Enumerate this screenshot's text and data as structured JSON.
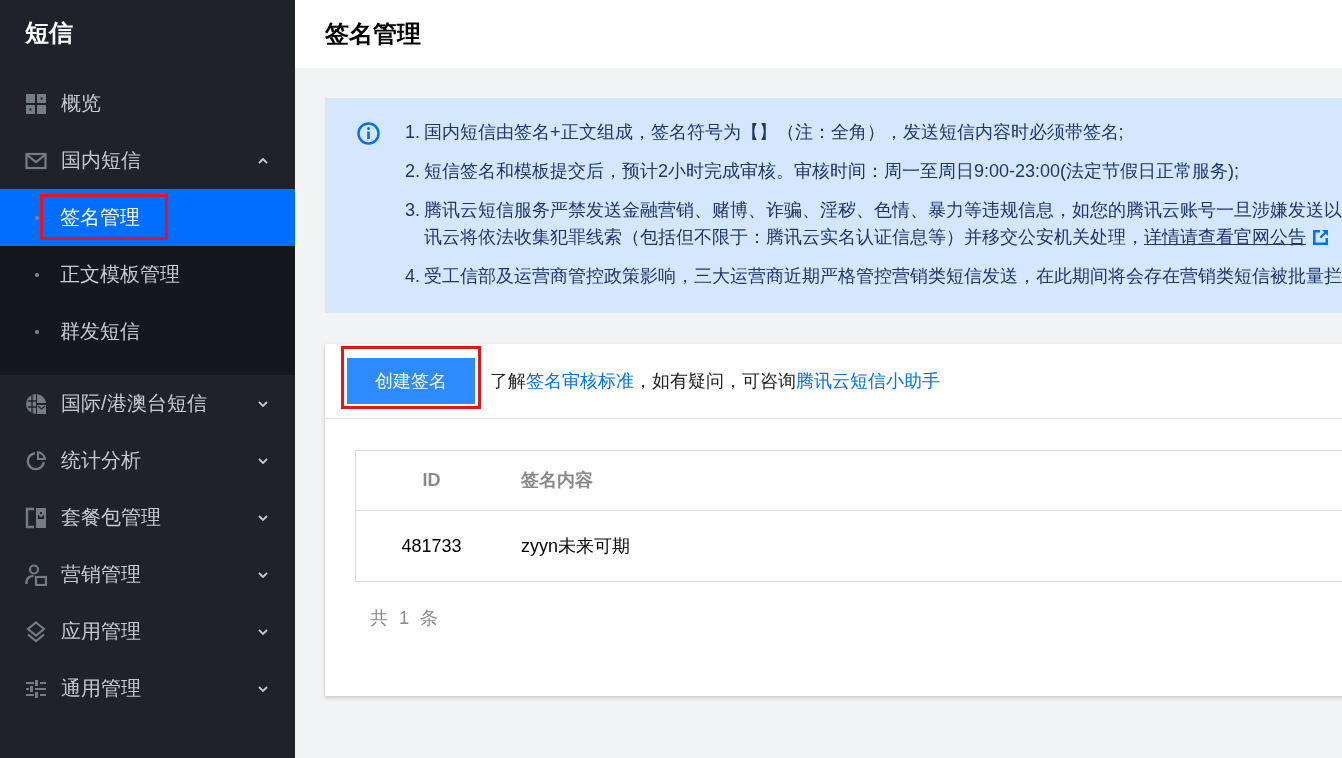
{
  "sidebar": {
    "title": "短信",
    "items": [
      {
        "label": "概览",
        "kind": "link",
        "selected": false
      },
      {
        "label": "国内短信",
        "kind": "group",
        "selected": false,
        "expanded": true,
        "children": [
          {
            "label": "签名管理",
            "selected": true,
            "highlighted": true
          },
          {
            "label": "正文模板管理",
            "selected": false,
            "highlighted": false
          },
          {
            "label": "群发短信",
            "selected": false,
            "highlighted": false
          }
        ]
      },
      {
        "label": "国际/港澳台短信",
        "kind": "group",
        "selected": false,
        "expanded": false
      },
      {
        "label": "统计分析",
        "kind": "group",
        "selected": false,
        "expanded": false
      },
      {
        "label": "套餐包管理",
        "kind": "group",
        "selected": false,
        "expanded": false
      },
      {
        "label": "营销管理",
        "kind": "group",
        "selected": false,
        "expanded": false
      },
      {
        "label": "应用管理",
        "kind": "group",
        "selected": false,
        "expanded": false
      },
      {
        "label": "通用管理",
        "kind": "group",
        "selected": false,
        "expanded": false
      }
    ]
  },
  "page": {
    "title": "签名管理"
  },
  "notice": {
    "items": [
      {
        "number": "1.",
        "text": "国内短信由签名+正文组成，签名符号为【】（注：全角），发送短信内容时必须带签名;"
      },
      {
        "number": "2.",
        "text": "短信签名和模板提交后，预计2小时完成审核。审核时间：周一至周日9:00-23:00(法定节假日正常服务);"
      },
      {
        "number": "3.",
        "text": "腾讯云短信服务严禁发送金融营销、赌博、诈骗、淫秽、色情、暴力等违规信息，如您的腾讯云账号一旦涉嫌发送以",
        "continuation": "讯云将依法收集犯罪线索（包括但不限于：腾讯云实名认证信息等）并移交公安机关处理，",
        "link": "详情请查看官网公告"
      },
      {
        "number": "4.",
        "text": "受工信部及运营商管控政策影响，三大运营商近期严格管控营销类短信发送，在此期间将会存在营销类短信被批量拦"
      }
    ]
  },
  "toolbar": {
    "button": {
      "label": "创建签名",
      "highlighted": true
    },
    "hint": [
      {
        "kind": "text",
        "text": "了解"
      },
      {
        "kind": "link",
        "text": "签名审核标准"
      },
      {
        "kind": "text",
        "text": "，如有疑问，可咨询"
      },
      {
        "kind": "link",
        "text": "腾讯云短信小助手"
      }
    ]
  },
  "table": {
    "columns": [
      "ID",
      "签名内容"
    ],
    "rows": [
      [
        "481733",
        "zyyn未来可期"
      ]
    ]
  },
  "pagination": {
    "total": "共 1 条"
  }
}
